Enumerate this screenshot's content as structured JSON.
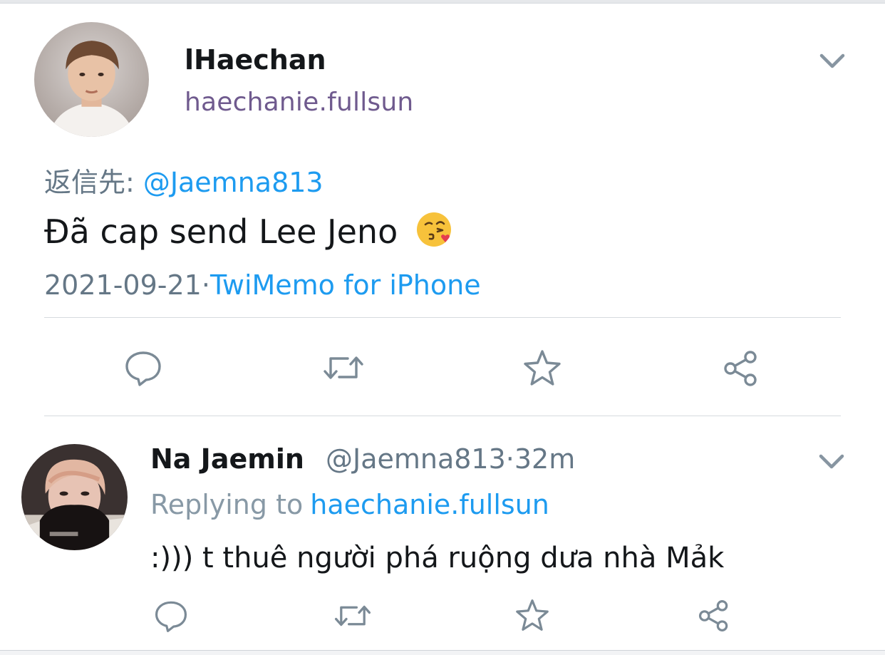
{
  "tweet": {
    "author": {
      "display_name": "lHaechan",
      "handle": "haechanie.fullsun",
      "avatar_icon": "user-avatar-photo"
    },
    "reply_prefix": "返信先:",
    "reply_to": "@Jaemna813",
    "text": "Đã cap send Lee Jeno",
    "emoji": "face-blowing-a-kiss",
    "date": "2021-09-21",
    "separator": "·",
    "source": "TwiMemo for iPhone",
    "actions": [
      "reply-icon",
      "retweet-icon",
      "star-icon",
      "share-icon"
    ],
    "menu_icon": "chevron-down-icon"
  },
  "reply": {
    "author": {
      "display_name": "Na Jaemin",
      "handle": "@Jaemna813",
      "time": "·32m",
      "avatar_icon": "user-avatar-photo"
    },
    "replying_prefix": "Replying to",
    "replying_target": "haechanie.fullsun",
    "text": ":))) t thuê người phá ruộng dưa nhà Mảk",
    "actions": [
      "reply-icon",
      "retweet-icon",
      "star-icon",
      "share-icon"
    ],
    "menu_icon": "chevron-down-icon"
  },
  "colors": {
    "link": "#1d9bf0",
    "muted": "#657786",
    "handle": "#6f5a8e",
    "text": "#14171a",
    "icon": "#7b8a96"
  }
}
